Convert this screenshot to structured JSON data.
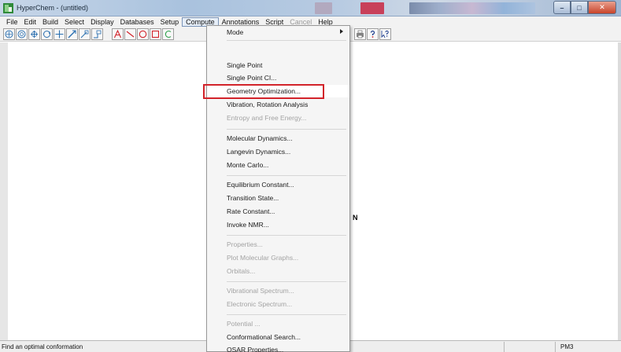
{
  "window": {
    "title": "HyperChem - (untitled)",
    "icon": "hyperchem-app-icon",
    "controls": [
      "minimize-icon",
      "maximize-icon",
      "close-icon"
    ]
  },
  "menubar": {
    "items": [
      {
        "label": "File",
        "state": "normal"
      },
      {
        "label": "Edit",
        "state": "normal"
      },
      {
        "label": "Build",
        "state": "normal"
      },
      {
        "label": "Select",
        "state": "normal"
      },
      {
        "label": "Display",
        "state": "normal"
      },
      {
        "label": "Databases",
        "state": "normal"
      },
      {
        "label": "Setup",
        "state": "normal"
      },
      {
        "label": "Compute",
        "state": "active"
      },
      {
        "label": "Annotations",
        "state": "normal"
      },
      {
        "label": "Script",
        "state": "normal"
      },
      {
        "label": "Cancel",
        "state": "disabled"
      },
      {
        "label": "Help",
        "state": "normal"
      }
    ]
  },
  "toolbar": {
    "tools": [
      "draw-tool-icon",
      "select-tool-icon",
      "rotate-out-of-plane-icon",
      "rotate-in-plane-icon",
      "translate-tool-icon",
      "z-translate-icon",
      "zoom-tool-icon",
      "z-clip-icon",
      "text-annotation-icon",
      "line-annotation-icon",
      "ellipse-annotation-icon",
      "rectangle-annotation-icon",
      "print-icon",
      "help-icon",
      "context-help-icon"
    ],
    "accent_colors": {
      "annotation_tools": "#d2232a",
      "selection_tools": "#2a6fb0"
    }
  },
  "workspace": {
    "atom_label": "N"
  },
  "compute_menu": {
    "items": [
      {
        "label": "Mode",
        "state": "normal",
        "submenu": true
      },
      {
        "label": "Single Point",
        "state": "normal"
      },
      {
        "label": "Single Point CI...",
        "state": "normal"
      },
      {
        "label": "Geometry Optimization...",
        "state": "highlighted"
      },
      {
        "label": "Vibration, Rotation Analysis",
        "state": "normal"
      },
      {
        "label": "Entropy and Free Energy...",
        "state": "disabled"
      },
      {
        "label": "Molecular Dynamics...",
        "state": "normal"
      },
      {
        "label": "Langevin Dynamics...",
        "state": "normal"
      },
      {
        "label": "Monte Carlo...",
        "state": "normal"
      },
      {
        "label": "Equilibrium Constant...",
        "state": "normal"
      },
      {
        "label": "Transition State...",
        "state": "normal"
      },
      {
        "label": "Rate Constant...",
        "state": "normal"
      },
      {
        "label": "Invoke NMR...",
        "state": "normal"
      },
      {
        "label": "Properties...",
        "state": "disabled"
      },
      {
        "label": "Plot Molecular Graphs...",
        "state": "disabled"
      },
      {
        "label": "Orbitals...",
        "state": "disabled"
      },
      {
        "label": "Vibrational Spectrum...",
        "state": "disabled"
      },
      {
        "label": "Electronic Spectrum...",
        "state": "disabled"
      },
      {
        "label": "Potential ...",
        "state": "disabled"
      },
      {
        "label": "Conformational Search...",
        "state": "normal"
      },
      {
        "label": "QSAR Properties...",
        "state": "normal"
      }
    ],
    "highlight_color": "#d2232a"
  },
  "statusbar": {
    "message": "Find an optimal conformation",
    "method": "PM3"
  }
}
